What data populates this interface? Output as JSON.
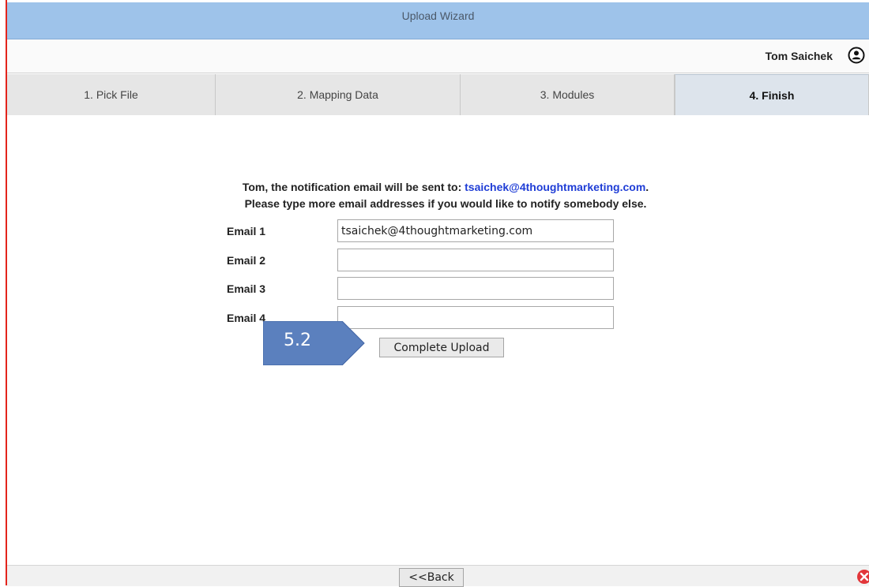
{
  "window": {
    "title": "Upload Wizard"
  },
  "user": {
    "name": "Tom Saichek",
    "icon": "user-circle-icon"
  },
  "tabs": [
    {
      "label": "1. Pick File",
      "active": false
    },
    {
      "label": "2. Mapping Data",
      "active": false
    },
    {
      "label": "3. Modules",
      "active": false
    },
    {
      "label": "4. Finish",
      "active": true
    }
  ],
  "notice": {
    "line1_prefix": "Tom, the notification email will be sent to: ",
    "email": "tsaichek@4thoughtmarketing.com",
    "line1_suffix": ".",
    "line2": "Please type more email addresses if you would like to notify somebody else."
  },
  "form": {
    "fields": [
      {
        "label": "Email 1",
        "value": "tsaichek@4thoughtmarketing.com"
      },
      {
        "label": "Email 2",
        "value": ""
      },
      {
        "label": "Email 3",
        "value": ""
      },
      {
        "label": "Email 4",
        "value": ""
      }
    ],
    "submit_label": "Complete Upload"
  },
  "callout": {
    "label": "5.2",
    "color": "#5b80be"
  },
  "footer": {
    "back_label": "<<Back"
  },
  "colors": {
    "title_bar": "#9ec3ea",
    "frame_border": "#e3241c",
    "link": "#1f3dd6",
    "close": "#e2363a"
  }
}
